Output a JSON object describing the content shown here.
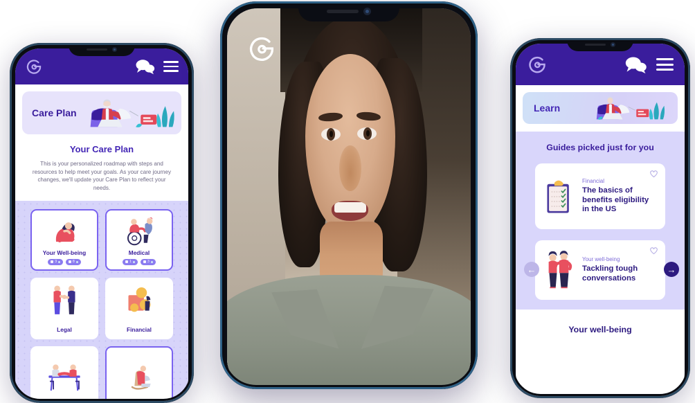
{
  "app": {
    "brand_name": "care-app",
    "header_bg": "#3a1d9c",
    "accent": "#4326b5",
    "icons": {
      "logo": "brand-logo-icon",
      "chat": "chat-bubbles-icon",
      "menu": "hamburger-menu-icon"
    }
  },
  "left_phone": {
    "screen_name": "Care Plan",
    "banner": {
      "title": "Care Plan",
      "illustration": "person-reading-in-armchair-illustration"
    },
    "intro": {
      "heading": "Your Care Plan",
      "body": "This is your personalized roadmap with steps and resources to help meet your goals. As your care journey changes, we'll update your Care Plan to reflect your needs."
    },
    "cards": [
      {
        "label": "Your Well-being",
        "illustration": "seated-person-illustration",
        "selected": true,
        "pills": [
          {
            "value": "3"
          },
          {
            "value": "8"
          }
        ]
      },
      {
        "label": "Medical",
        "illustration": "wheelchair-caregiver-illustration",
        "selected": true,
        "pills": [
          {
            "value": "1"
          },
          {
            "value": "3"
          }
        ]
      },
      {
        "label": "Legal",
        "illustration": "handshake-illustration",
        "selected": false,
        "pills": []
      },
      {
        "label": "Financial",
        "illustration": "coins-and-box-illustration",
        "selected": false,
        "pills": []
      },
      {
        "label": "",
        "illustration": "people-at-table-illustration",
        "selected": false,
        "pills": []
      },
      {
        "label": "",
        "illustration": "person-in-rocking-chair-illustration",
        "selected": true,
        "pills": []
      }
    ]
  },
  "center_phone": {
    "screen_name": "video-call",
    "subject_alt": "smiling woman in sage collared shirt on video call",
    "logo": "brand-logo-icon"
  },
  "right_phone": {
    "screen_name": "Learn",
    "banner": {
      "title": "Learn",
      "illustration": "person-reading-in-armchair-illustration"
    },
    "section_heading": "Guides picked just for you",
    "guides": [
      {
        "category": "Financial",
        "title": "The basics of benefits eligibility in the US",
        "illustration": "clipboard-checklist-illustration",
        "favorite_icon": "heart-outline-icon"
      },
      {
        "category": "Your well-being",
        "title": "Tackling tough conversations",
        "illustration": "two-people-standing-illustration",
        "favorite_icon": "heart-outline-icon"
      }
    ],
    "carousel": {
      "prev_label": "←",
      "next_label": "→",
      "prev_disabled": true
    },
    "footer_heading": "Your well-being"
  }
}
